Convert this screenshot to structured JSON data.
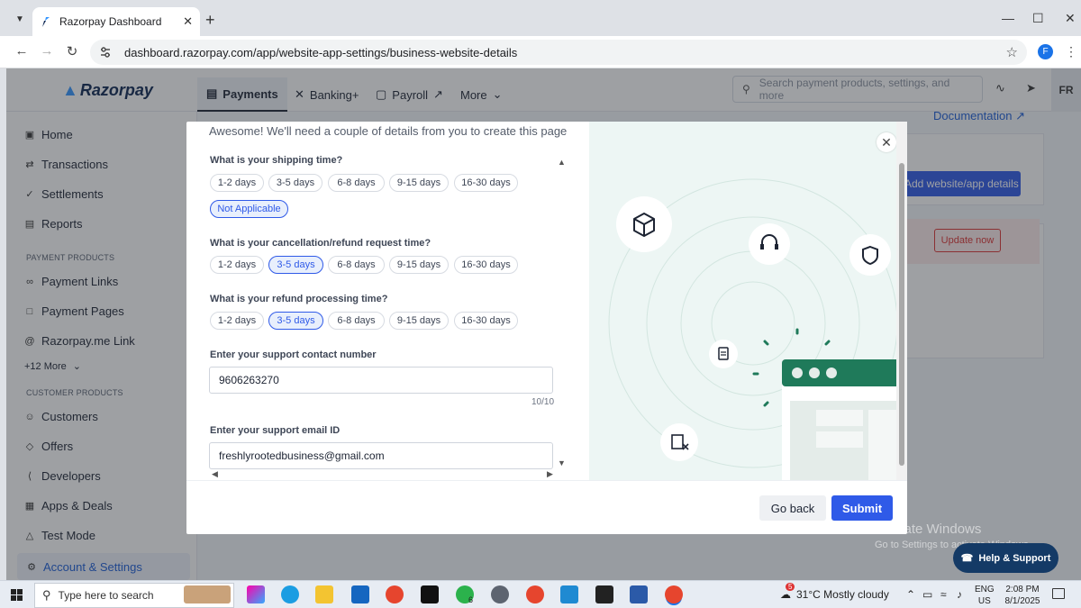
{
  "browser": {
    "tab_title": "Razorpay Dashboard",
    "url": "dashboard.razorpay.com/app/website-app-settings/business-website-details",
    "profile_initial": "F"
  },
  "app": {
    "logo": "Razorpay",
    "nav": [
      "Payments",
      "Banking+",
      "Payroll",
      "More"
    ],
    "search_placeholder": "Search payment products, settings, and more",
    "user_initials": "FR",
    "sidebar": {
      "items_top": [
        "Home",
        "Transactions",
        "Settlements",
        "Reports"
      ],
      "section_payment": "PAYMENT PRODUCTS",
      "items_payment": [
        "Payment Links",
        "Payment Pages",
        "Razorpay.me Link",
        "+12 More"
      ],
      "section_customer": "CUSTOMER PRODUCTS",
      "items_customer": [
        "Customers",
        "Offers",
        "Developers",
        "Apps & Deals"
      ],
      "test_mode": "Test Mode",
      "account_settings": "Account & Settings"
    },
    "documentation_link": "Documentation",
    "add_details_button": "Add website/app details",
    "update_now_button": "Update now",
    "help_support": "Help & Support"
  },
  "modal": {
    "intro": "Awesome! We'll need a couple of details from you to create this page",
    "shipping": {
      "label": "What is your shipping time?",
      "options": [
        "1-2 days",
        "3-5 days",
        "6-8 days",
        "9-15 days",
        "16-30 days",
        "Not Applicable"
      ],
      "selected": "Not Applicable"
    },
    "cancellation": {
      "label": "What is your cancellation/refund request time?",
      "options": [
        "1-2 days",
        "3-5 days",
        "6-8 days",
        "9-15 days",
        "16-30 days"
      ],
      "selected": "3-5 days"
    },
    "refund": {
      "label": "What is your refund processing time?",
      "options": [
        "1-2 days",
        "3-5 days",
        "6-8 days",
        "9-15 days",
        "16-30 days"
      ],
      "selected": "3-5 days"
    },
    "contact": {
      "label": "Enter your support contact number",
      "value": "9606263270",
      "counter": "10/10"
    },
    "email": {
      "label": "Enter your support email ID",
      "value": "freshlyrootedbusiness@gmail.com"
    },
    "buttons": {
      "back": "Go back",
      "submit": "Submit"
    }
  },
  "os": {
    "watermark_line1": "Activate Windows",
    "watermark_line2": "Go to Settings to activate Windows.",
    "search_text": "Type here to search",
    "weather": "31°C  Mostly cloudy",
    "weather_badge": "5",
    "lang": "ENG",
    "region": "US",
    "time": "2:08 PM",
    "date": "8/1/2025",
    "whatsapp_badge": "6"
  },
  "colors": {
    "brand_blue": "#2f5ae8",
    "illustration_bg": "#edf6f4",
    "illustration_green": "#1f7a5a"
  }
}
